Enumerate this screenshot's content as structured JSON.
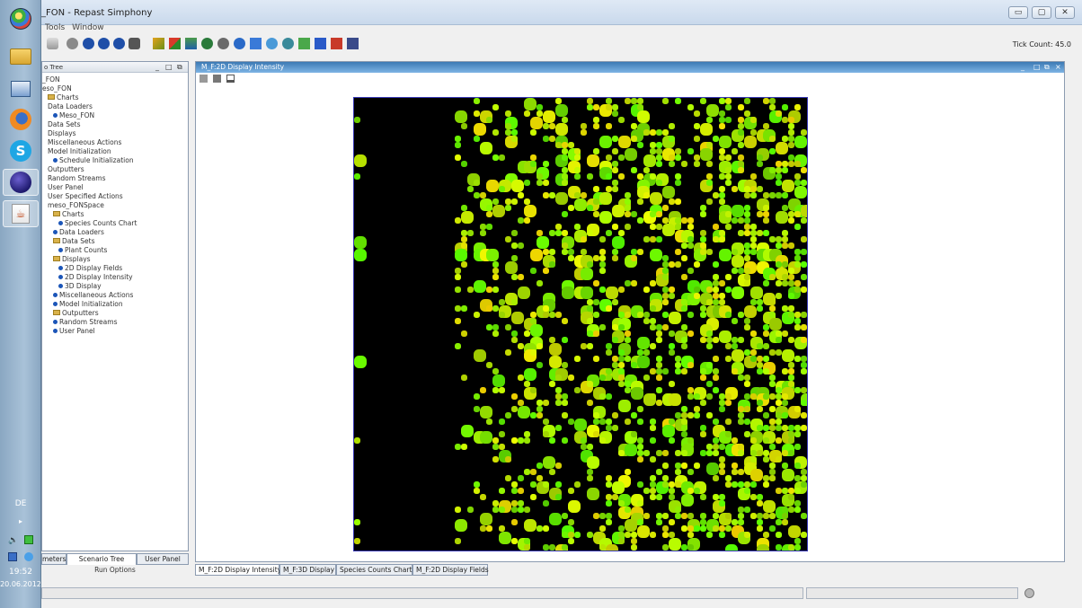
{
  "window": {
    "title": "_FON - Repast Simphony",
    "controls": {
      "minimize": "▭",
      "maximize": "▢",
      "close": "✕"
    }
  },
  "menu": {
    "items": [
      "Tools",
      "Window"
    ]
  },
  "toolbar": {
    "tick_count": "Tick Count: 45.0",
    "icons": [
      "save-icon",
      "stop-circle-icon",
      "play-icon",
      "step-icon",
      "pause-icon",
      "stop-icon",
      "reset-icon",
      "chart-icon",
      "grid-icon",
      "users-icon",
      "model-icon",
      "database-icon",
      "network-icon",
      "report-icon",
      "globe-icon",
      "user-icon",
      "image-icon",
      "layout-icon",
      "export-icon",
      "transport-icon"
    ]
  },
  "taskbar": {
    "apps": [
      "windows-start-icon",
      "file-explorer-icon",
      "network-icon",
      "firefox-icon",
      "skype-icon",
      "eclipse-icon",
      "java-icon"
    ],
    "language": "DE",
    "time": "19:52",
    "date": "20.06.2012"
  },
  "left_panel": {
    "header_title": "o Tree",
    "tree": [
      {
        "label": "_FON",
        "indent": 0,
        "icon": "none"
      },
      {
        "label": "eso_FON",
        "indent": 0,
        "icon": "none"
      },
      {
        "label": "Charts",
        "indent": 1,
        "icon": "folder"
      },
      {
        "label": "Data Loaders",
        "indent": 1,
        "icon": "none"
      },
      {
        "label": "Meso_FON",
        "indent": 2,
        "icon": "dot"
      },
      {
        "label": "Data Sets",
        "indent": 1,
        "icon": "none"
      },
      {
        "label": "Displays",
        "indent": 1,
        "icon": "none"
      },
      {
        "label": "Miscellaneous Actions",
        "indent": 1,
        "icon": "none"
      },
      {
        "label": "Model Initialization",
        "indent": 1,
        "icon": "none"
      },
      {
        "label": "Schedule Initialization",
        "indent": 2,
        "icon": "dot"
      },
      {
        "label": "Outputters",
        "indent": 1,
        "icon": "none"
      },
      {
        "label": "Random Streams",
        "indent": 1,
        "icon": "none"
      },
      {
        "label": "User Panel",
        "indent": 1,
        "icon": "none"
      },
      {
        "label": "User Specified Actions",
        "indent": 1,
        "icon": "none"
      },
      {
        "label": "meso_FONSpace",
        "indent": 1,
        "icon": "none"
      },
      {
        "label": "Charts",
        "indent": 2,
        "icon": "folder"
      },
      {
        "label": "Species Counts Chart",
        "indent": 3,
        "icon": "dot"
      },
      {
        "label": "Data Loaders",
        "indent": 2,
        "icon": "dot"
      },
      {
        "label": "Data Sets",
        "indent": 2,
        "icon": "folder"
      },
      {
        "label": "Plant Counts",
        "indent": 3,
        "icon": "dot"
      },
      {
        "label": "Displays",
        "indent": 2,
        "icon": "folder"
      },
      {
        "label": "2D Display Fields",
        "indent": 3,
        "icon": "dot"
      },
      {
        "label": "2D Display Intensity",
        "indent": 3,
        "icon": "dot"
      },
      {
        "label": "3D Display",
        "indent": 3,
        "icon": "dot"
      },
      {
        "label": "Miscellaneous Actions",
        "indent": 2,
        "icon": "dot"
      },
      {
        "label": "Model Initialization",
        "indent": 2,
        "icon": "dot"
      },
      {
        "label": "Outputters",
        "indent": 2,
        "icon": "folder"
      },
      {
        "label": "Random Streams",
        "indent": 2,
        "icon": "dot"
      },
      {
        "label": "User Panel",
        "indent": 2,
        "icon": "dot"
      }
    ],
    "tabs": [
      "meters",
      "Scenario Tree",
      "User Panel"
    ],
    "selected_tab": "Scenario Tree",
    "run_options": "Run Options"
  },
  "right_panel": {
    "header_title": "M_F:2D Display Intensity",
    "tools": [
      "zoom-icon",
      "pan-icon",
      "home-icon"
    ],
    "display": {
      "background": "#000000",
      "cell_color": "#66ff00"
    }
  },
  "bottom_tabs": [
    {
      "label": "M_F:2D Display Intensity",
      "selected": true
    },
    {
      "label": "M_F:3D Display",
      "selected": false
    },
    {
      "label": "Species Counts Chart",
      "selected": false
    },
    {
      "label": "M_F:2D Display Fields",
      "selected": false
    }
  ]
}
